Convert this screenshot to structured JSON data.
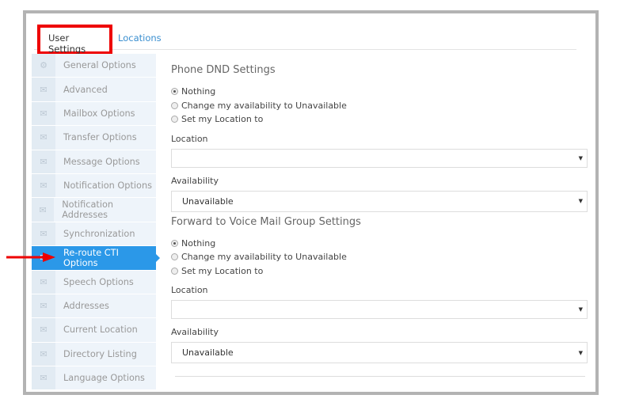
{
  "tabs": [
    {
      "label": "User Settings",
      "active": true
    },
    {
      "label": "Locations"
    }
  ],
  "sidebar": {
    "items": [
      {
        "label": "General Options",
        "icon": "gear-icon"
      },
      {
        "label": "Advanced",
        "icon": "envelope-icon"
      },
      {
        "label": "Mailbox Options",
        "icon": "envelope-icon"
      },
      {
        "label": "Transfer Options",
        "icon": "envelope-icon"
      },
      {
        "label": "Message Options",
        "icon": "envelope-icon"
      },
      {
        "label": "Notification Options",
        "icon": "envelope-icon"
      },
      {
        "label": "Notification Addresses",
        "icon": "envelope-icon"
      },
      {
        "label": "Synchronization",
        "icon": "envelope-icon"
      },
      {
        "label": "Re-route CTI Options",
        "icon": "envelope-icon",
        "active": true
      },
      {
        "label": "Speech Options",
        "icon": "envelope-icon"
      },
      {
        "label": "Addresses",
        "icon": "envelope-icon"
      },
      {
        "label": "Current Location",
        "icon": "envelope-icon"
      },
      {
        "label": "Directory Listing",
        "icon": "envelope-icon"
      },
      {
        "label": "Language Options",
        "icon": "envelope-icon"
      }
    ]
  },
  "sections": [
    {
      "title": "Phone DND Settings",
      "options": [
        "Nothing",
        "Change my availability to Unavailable",
        "Set my Location to"
      ],
      "selected": 0,
      "location_label": "Location",
      "location_value": "",
      "availability_label": "Availability",
      "availability_value": "Unavailable"
    },
    {
      "title": "Forward to Voice Mail Group Settings",
      "options": [
        "Nothing",
        "Change my availability to Unavailable",
        "Set my Location to"
      ],
      "selected": 0,
      "location_label": "Location",
      "location_value": "",
      "availability_label": "Availability",
      "availability_value": "Unavailable"
    }
  ],
  "colors": {
    "accent": "#2b98e8",
    "highlight": "#ee0000",
    "link": "#3a8fd0"
  }
}
